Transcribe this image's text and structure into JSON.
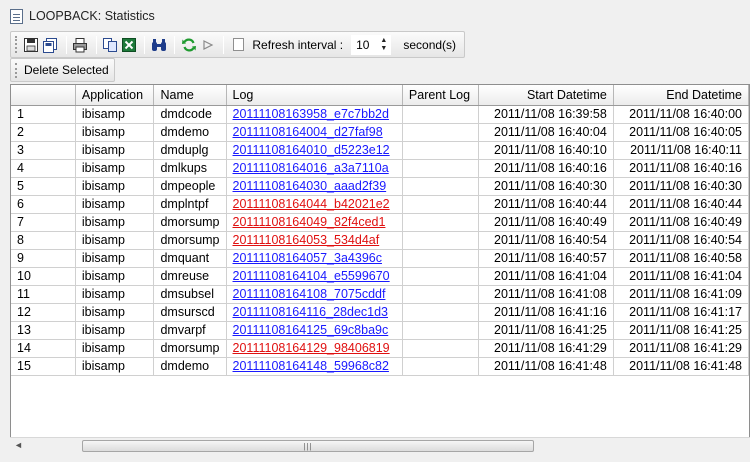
{
  "window": {
    "title": "LOOPBACK: Statistics"
  },
  "toolbar": {
    "refresh_label": "Refresh interval :",
    "refresh_value": "10",
    "seconds_label": "second(s)",
    "icons": [
      "save-icon",
      "save-as-icon",
      "print-icon",
      "copy-icon",
      "export-excel-icon",
      "find-icon",
      "refresh-icon",
      "run-icon"
    ]
  },
  "actions": {
    "delete_label": "Delete Selected"
  },
  "grid": {
    "columns": [
      "Application",
      "Name",
      "Log",
      "Parent Log",
      "Start Datetime",
      "End Datetime"
    ],
    "rows": [
      {
        "idx": "1",
        "app": "ibisamp",
        "name": "dmdcode",
        "log": "20111108163958_e7c7bb2d",
        "color": "blue",
        "parent": "",
        "start": "2011/11/08 16:39:58",
        "end": "2011/11/08 16:40:00"
      },
      {
        "idx": "2",
        "app": "ibisamp",
        "name": "dmdemo",
        "log": "20111108164004_d27faf98",
        "color": "blue",
        "parent": "",
        "start": "2011/11/08 16:40:04",
        "end": "2011/11/08 16:40:05"
      },
      {
        "idx": "3",
        "app": "ibisamp",
        "name": "dmduplg",
        "log": "20111108164010_d5223e12",
        "color": "blue",
        "parent": "",
        "start": "2011/11/08 16:40:10",
        "end": "2011/11/08 16:40:11"
      },
      {
        "idx": "4",
        "app": "ibisamp",
        "name": "dmlkups",
        "log": "20111108164016_a3a7110a",
        "color": "blue",
        "parent": "",
        "start": "2011/11/08 16:40:16",
        "end": "2011/11/08 16:40:16"
      },
      {
        "idx": "5",
        "app": "ibisamp",
        "name": "dmpeople",
        "log": "20111108164030_aaad2f39",
        "color": "blue",
        "parent": "",
        "start": "2011/11/08 16:40:30",
        "end": "2011/11/08 16:40:30"
      },
      {
        "idx": "6",
        "app": "ibisamp",
        "name": "dmplntpf",
        "log": "20111108164044_b42021e2",
        "color": "red",
        "parent": "",
        "start": "2011/11/08 16:40:44",
        "end": "2011/11/08 16:40:44"
      },
      {
        "idx": "7",
        "app": "ibisamp",
        "name": "dmorsump",
        "log": "20111108164049_82f4ced1",
        "color": "red",
        "parent": "",
        "start": "2011/11/08 16:40:49",
        "end": "2011/11/08 16:40:49"
      },
      {
        "idx": "8",
        "app": "ibisamp",
        "name": "dmorsump",
        "log": "20111108164053_534d4af",
        "color": "red",
        "parent": "",
        "start": "2011/11/08 16:40:54",
        "end": "2011/11/08 16:40:54"
      },
      {
        "idx": "9",
        "app": "ibisamp",
        "name": "dmquant",
        "log": "20111108164057_3a4396c",
        "color": "blue",
        "parent": "",
        "start": "2011/11/08 16:40:57",
        "end": "2011/11/08 16:40:58"
      },
      {
        "idx": "10",
        "app": "ibisamp",
        "name": "dmreuse",
        "log": "20111108164104_e5599670",
        "color": "blue",
        "parent": "",
        "start": "2011/11/08 16:41:04",
        "end": "2011/11/08 16:41:04"
      },
      {
        "idx": "11",
        "app": "ibisamp",
        "name": "dmsubsel",
        "log": "20111108164108_7075cddf",
        "color": "blue",
        "parent": "",
        "start": "2011/11/08 16:41:08",
        "end": "2011/11/08 16:41:09"
      },
      {
        "idx": "12",
        "app": "ibisamp",
        "name": "dmsurscd",
        "log": "20111108164116_28dec1d3",
        "color": "blue",
        "parent": "",
        "start": "2011/11/08 16:41:16",
        "end": "2011/11/08 16:41:17"
      },
      {
        "idx": "13",
        "app": "ibisamp",
        "name": "dmvarpf",
        "log": "20111108164125_69c8ba9c",
        "color": "blue",
        "parent": "",
        "start": "2011/11/08 16:41:25",
        "end": "2011/11/08 16:41:25"
      },
      {
        "idx": "14",
        "app": "ibisamp",
        "name": "dmorsump",
        "log": "20111108164129_98406819",
        "color": "red",
        "parent": "",
        "start": "2011/11/08 16:41:29",
        "end": "2011/11/08 16:41:29"
      },
      {
        "idx": "15",
        "app": "ibisamp",
        "name": "dmdemo",
        "log": "20111108164148_59968c82",
        "color": "blue",
        "parent": "",
        "start": "2011/11/08 16:41:48",
        "end": "2011/11/08 16:41:48"
      }
    ]
  },
  "colors": {
    "link_blue": "#1a1aff",
    "link_red": "#e01010"
  }
}
